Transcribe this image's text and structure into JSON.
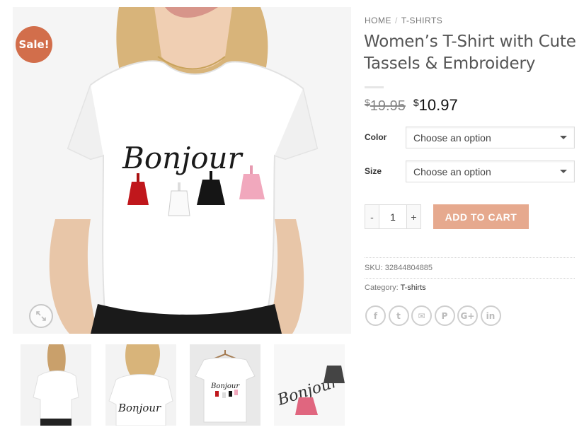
{
  "gallery": {
    "sale_badge": "Sale!",
    "main_image_alt": "Women's T-Shirt with Cute Tassels & Embroidery",
    "embroidery_text": "Bonjour",
    "thumbnails": [
      "thumb-back",
      "thumb-front",
      "thumb-hanger",
      "thumb-detail"
    ]
  },
  "breadcrumb": {
    "home": "HOME",
    "separator": "/",
    "category": "T-SHIRTS"
  },
  "product": {
    "title": "Women’s T-Shirt with Cute Tassels & Embroidery",
    "currency": "$",
    "old_price": "19.95",
    "new_price": "10.97"
  },
  "variations": {
    "color_label": "Color",
    "color_value": "Choose an option",
    "size_label": "Size",
    "size_value": "Choose an option"
  },
  "cart": {
    "minus": "-",
    "quantity": "1",
    "plus": "+",
    "add_label": "ADD TO CART"
  },
  "meta": {
    "sku_label": "SKU:",
    "sku_value": "32844804885",
    "category_label": "Category:",
    "category_value": "T-shirts"
  },
  "share": [
    {
      "name": "facebook-icon",
      "glyph": "f"
    },
    {
      "name": "twitter-icon",
      "glyph": "t"
    },
    {
      "name": "email-icon",
      "glyph": "✉"
    },
    {
      "name": "pinterest-icon",
      "glyph": "P"
    },
    {
      "name": "google-plus-icon",
      "glyph": "G+"
    },
    {
      "name": "linkedin-icon",
      "glyph": "in"
    }
  ],
  "colors": {
    "sale": "#d26e4b",
    "button": "#e6a98e",
    "text": "#555555"
  }
}
